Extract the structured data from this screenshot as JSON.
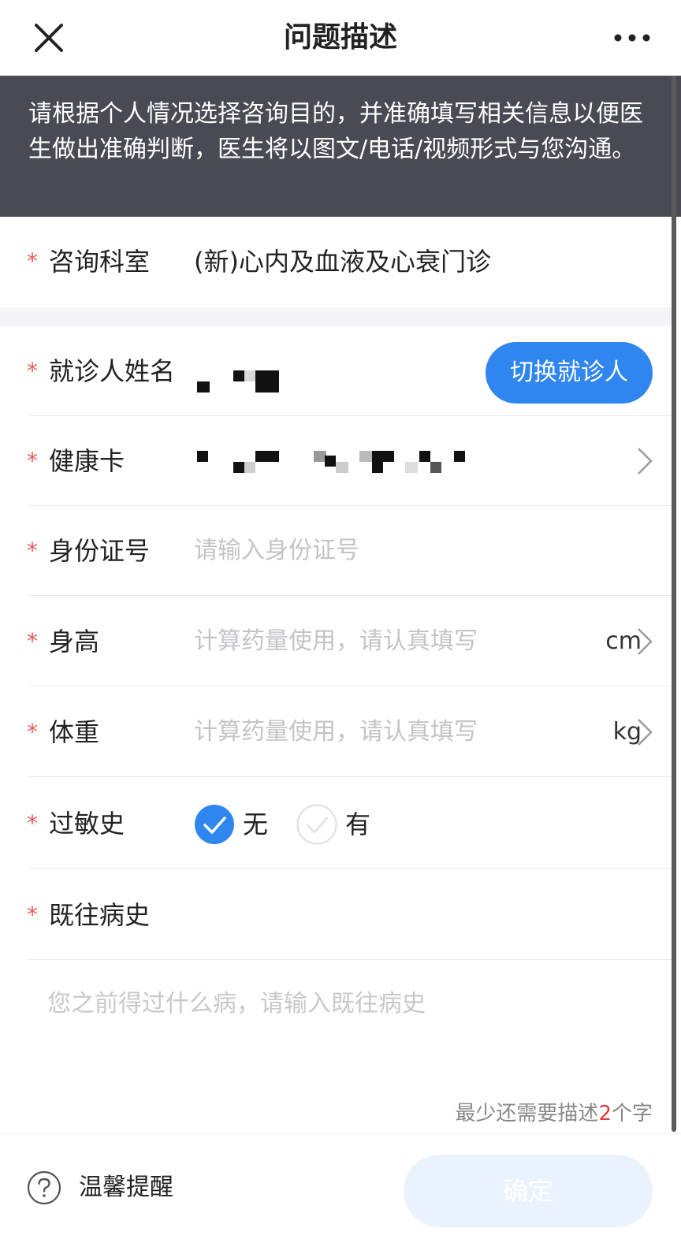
{
  "header": {
    "title": "问题描述",
    "close_icon": "close-icon",
    "more_icon": "more-icon"
  },
  "notice": {
    "text": "请根据个人情况选择咨询目的，并准确填写相关信息以便医生做出准确判断，医生将以图文/电话/视频形式与您沟通。"
  },
  "form": {
    "required_mark": "*",
    "department": {
      "label": "咨询科室",
      "value": "(新)心内及血液及心衰门诊"
    },
    "patient_name": {
      "label": "就诊人姓名",
      "switch_label": "切换就诊人"
    },
    "health_card": {
      "label": "健康卡"
    },
    "id_number": {
      "label": "身份证号",
      "placeholder": "请输入身份证号"
    },
    "height": {
      "label": "身高",
      "placeholder": "计算药量使用，请认真填写",
      "unit": "cm"
    },
    "weight": {
      "label": "体重",
      "placeholder": "计算药量使用，请认真填写",
      "unit": "kg"
    },
    "allergy": {
      "label": "过敏史",
      "options": [
        {
          "label": "无",
          "selected": true
        },
        {
          "label": "有",
          "selected": false
        }
      ]
    },
    "history": {
      "label": "既往病史",
      "placeholder": "您之前得过什么病，请输入既往病史",
      "counter_prefix": "最少还需要描述",
      "counter_num": "2",
      "counter_suffix": "个字"
    }
  },
  "footer": {
    "tips_label": "温馨提醒",
    "confirm_label": "确定"
  },
  "colors": {
    "accent": "#2f86ef",
    "notice_bg": "#4a4a55",
    "required": "#e85a5a",
    "confirm_disabled": "#eaf2fe"
  }
}
